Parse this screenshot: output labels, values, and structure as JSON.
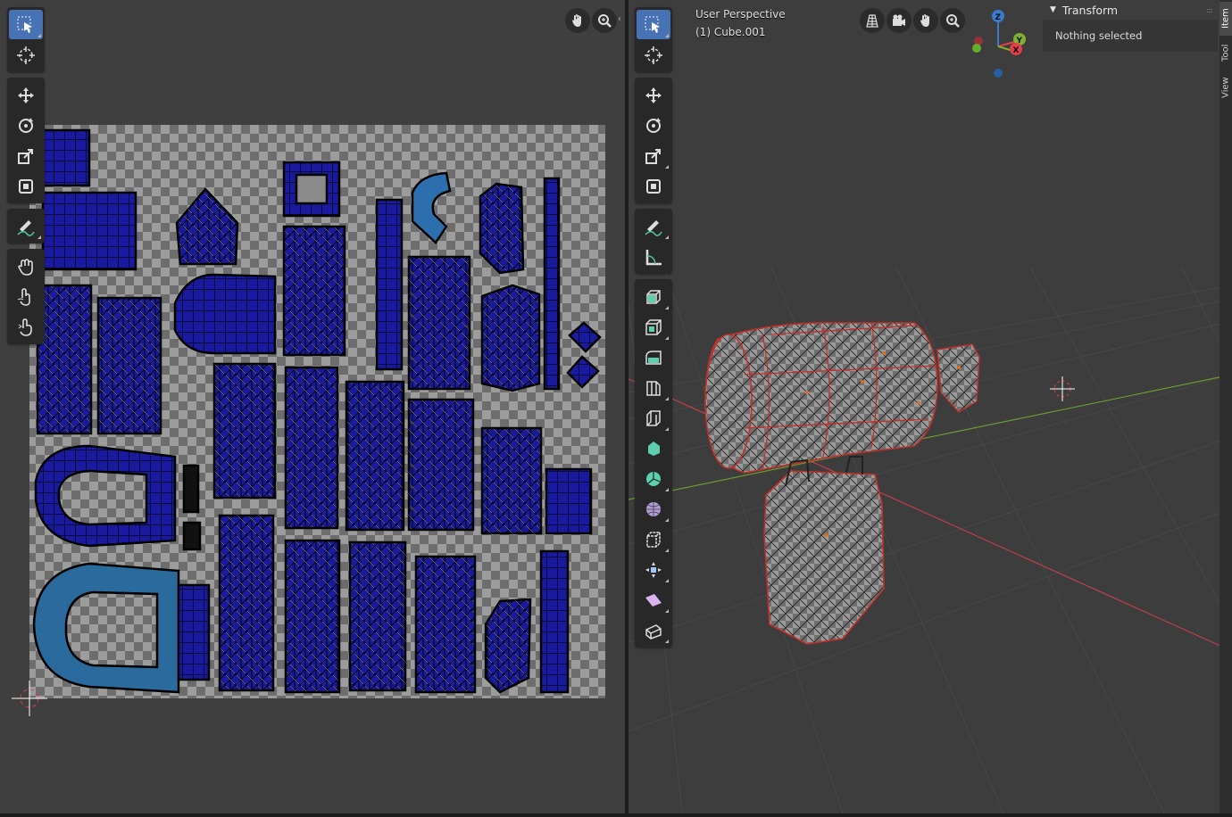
{
  "uv_editor": {
    "tools": [
      "select-box",
      "cursor",
      "move",
      "rotate",
      "scale",
      "transform",
      "annotate",
      "grab",
      "relax",
      "pinch"
    ]
  },
  "viewport": {
    "perspective_label": "User Perspective",
    "object_label": "(1) Cube.001",
    "tools": [
      "select-box",
      "cursor",
      "move",
      "rotate",
      "scale",
      "transform",
      "annotate",
      "measure",
      "add-cube",
      "extrude-region",
      "inset-faces",
      "bevel",
      "loop-cut",
      "knife",
      "poly-build",
      "spin",
      "smooth",
      "edge-slide",
      "shrink-fatten",
      "shear",
      "rip-region"
    ],
    "gizmo": {
      "z_label": "Z",
      "y_label": "Y",
      "x_label": "X"
    }
  },
  "side_panel": {
    "header": "Transform",
    "body": "Nothing selected",
    "tabs": [
      "Item",
      "Tool",
      "View"
    ],
    "active_tab": "Item"
  },
  "colors": {
    "accent": "#4772b3",
    "uv_island": "#1a1a9e",
    "selection_outline": "#e0341e"
  }
}
